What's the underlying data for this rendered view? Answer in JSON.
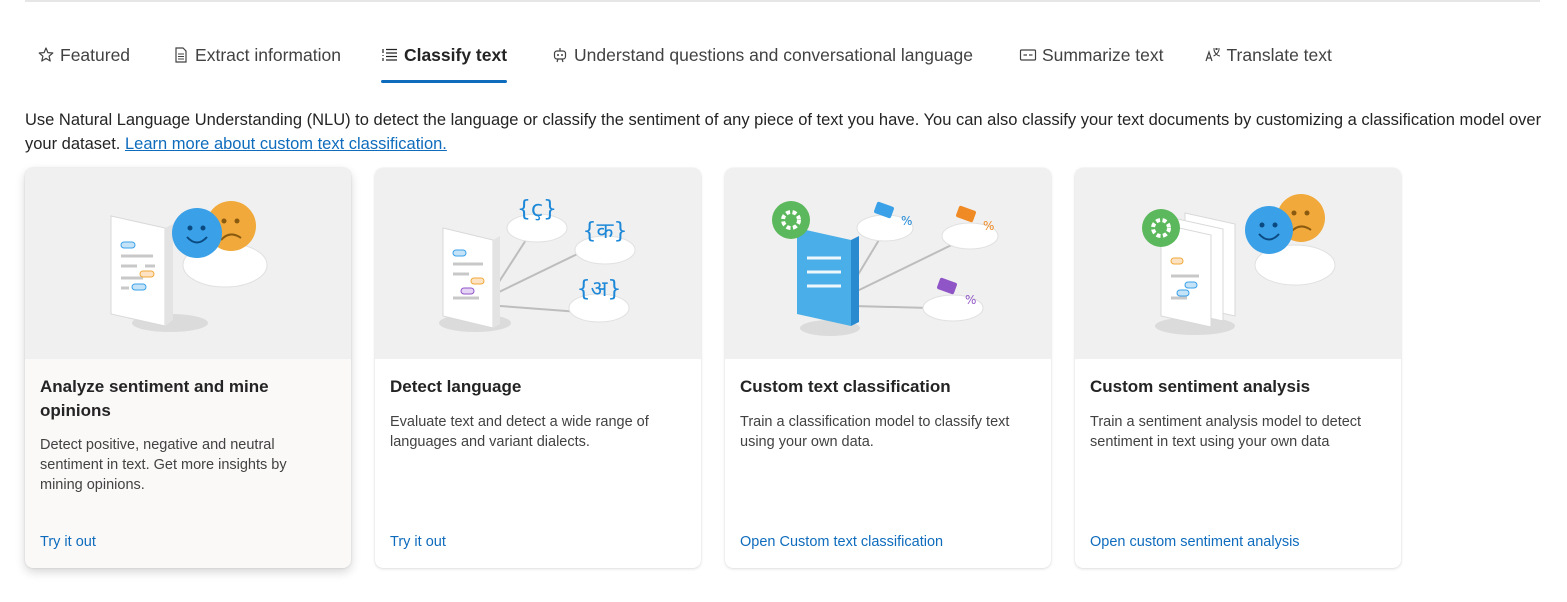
{
  "tabs": [
    {
      "label": "Featured",
      "icon": "star-icon"
    },
    {
      "label": "Extract information",
      "icon": "document-icon"
    },
    {
      "label": "Classify text",
      "icon": "text-list-icon",
      "active": true
    },
    {
      "label": "Understand questions and conversational language",
      "icon": "bot-icon"
    },
    {
      "label": "Summarize text",
      "icon": "summary-icon"
    },
    {
      "label": "Translate text",
      "icon": "translate-icon"
    }
  ],
  "intro": {
    "text": "Use Natural Language Understanding (NLU) to detect the language or classify the sentiment of any piece of text you have. You can also classify your text documents by customizing a classification model over your dataset.",
    "link": "Learn more about custom text classification."
  },
  "cards": [
    {
      "title": "Analyze sentiment and mine opinions",
      "description": "Detect positive, negative and neutral sentiment in text. Get more insights by mining opinions.",
      "link": "Try it out"
    },
    {
      "title": "Detect language",
      "description": "Evaluate text and detect a wide range of languages and variant dialects.",
      "link": "Try it out"
    },
    {
      "title": "Custom text classification",
      "description": "Train a classification model to classify text using your own data.",
      "link": "Open Custom text classification"
    },
    {
      "title": "Custom sentiment analysis",
      "description": "Train a sentiment analysis model to detect sentiment in text using your own data",
      "link": "Open custom sentiment analysis"
    }
  ],
  "illustration_glyphs": {
    "lang1": "{ç}",
    "lang2": "{क}",
    "lang3": "{अ}",
    "percent": "%"
  },
  "colors": {
    "accent": "#0f6cbd",
    "happy_face": "#3aa0e8",
    "sad_face": "#f0a93a",
    "gear": "#5cb85c",
    "tag_blue": "#3aa0e8",
    "tag_orange": "#f08a24",
    "tag_purple": "#8f55c7"
  }
}
